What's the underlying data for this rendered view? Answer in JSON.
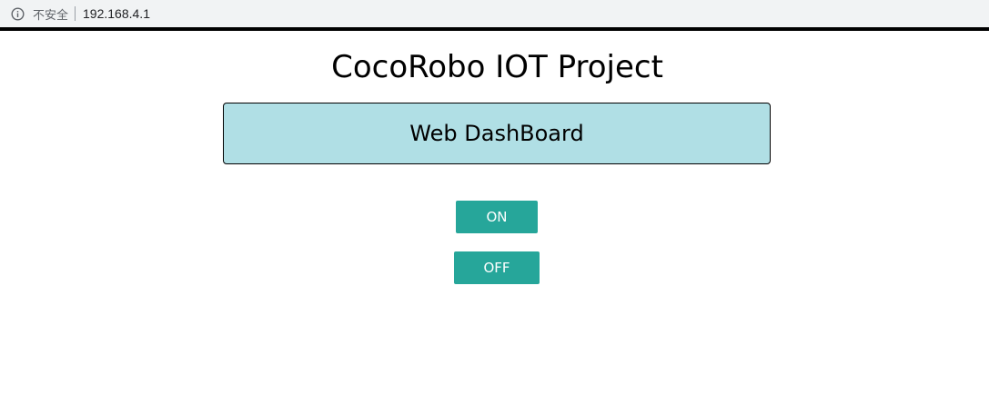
{
  "browser": {
    "security_label": "不安全",
    "url": "192.168.4.1",
    "info_icon": "info-circle-icon"
  },
  "page": {
    "title": "CocoRobo IOT Project",
    "panel_title": "Web DashBoard"
  },
  "controls": {
    "on_label": "ON",
    "off_label": "OFF",
    "button_color": "#26a69a",
    "panel_color": "#b0dfe5"
  }
}
